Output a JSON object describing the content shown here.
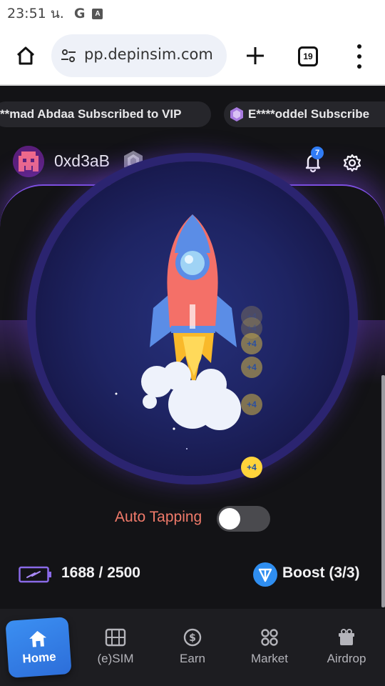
{
  "status_bar": {
    "time": "23:51 น.",
    "icons": [
      "google-g-icon",
      "a-box-icon"
    ]
  },
  "browser": {
    "url": "pp.depinsim.com",
    "tab_count": "19"
  },
  "ticker": [
    {
      "text": "**mad Abdaa Subscribed to VIP"
    },
    {
      "text": "E****oddel Subscribe"
    }
  ],
  "header": {
    "username": "0xd3aB",
    "notification_count": "7"
  },
  "main": {
    "auto_tapping_label": "Auto Tapping",
    "auto_tapping_on": false,
    "tap_bonus": "+4",
    "energy": "1688 / 2500",
    "boost": "Boost (3/3)"
  },
  "colors": {
    "accent": "#3b8ff2",
    "auto_label": "#f07a6a",
    "panel_border": "#7d4fe0"
  },
  "bottom_nav": [
    {
      "label": "Home",
      "icon": "home-icon",
      "active": true
    },
    {
      "label": "(e)SIM",
      "icon": "sim-card-icon",
      "active": false
    },
    {
      "label": "Earn",
      "icon": "dollar-coin-icon",
      "active": false
    },
    {
      "label": "Market",
      "icon": "grid-icon",
      "active": false
    },
    {
      "label": "Airdrop",
      "icon": "gift-icon",
      "active": false
    }
  ]
}
